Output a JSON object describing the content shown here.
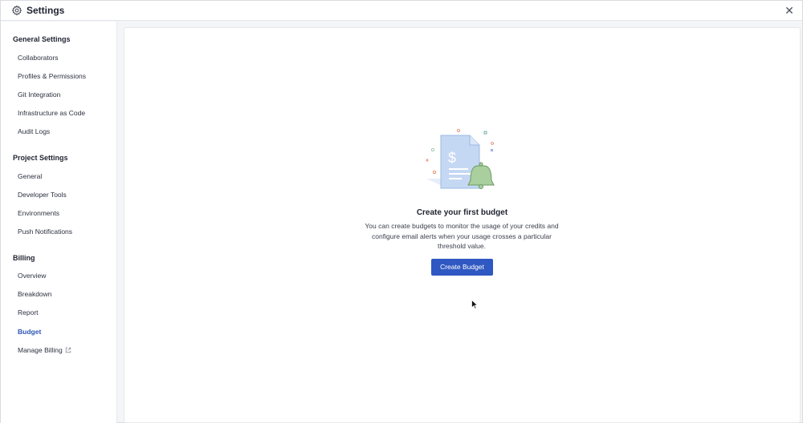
{
  "window": {
    "title": "Settings",
    "title_icon": "gear-icon",
    "close_glyph": "✕"
  },
  "sidebar": {
    "sections": [
      {
        "title": "General Settings",
        "items": [
          {
            "label": "Collaborators"
          },
          {
            "label": "Profiles & Permissions"
          },
          {
            "label": "Git Integration"
          },
          {
            "label": "Infrastructure as Code"
          },
          {
            "label": "Audit Logs"
          }
        ]
      },
      {
        "title": "Project Settings",
        "items": [
          {
            "label": "General"
          },
          {
            "label": "Developer Tools"
          },
          {
            "label": "Environments"
          },
          {
            "label": "Push Notifications"
          }
        ]
      },
      {
        "title": "Billing",
        "items": [
          {
            "label": "Overview"
          },
          {
            "label": "Breakdown"
          },
          {
            "label": "Report"
          },
          {
            "label": "Budget",
            "active": true
          },
          {
            "label": "Manage Billing",
            "icon": "external-link-icon"
          }
        ]
      }
    ]
  },
  "main": {
    "empty_state": {
      "illustration": "budget-document-bell-illustration",
      "illustration_symbol": "$",
      "title": "Create your first budget",
      "description": "You can create budgets to monitor the usage of your credits and configure email alerts when your usage crosses a particular threshold value.",
      "button_label": "Create Budget"
    }
  },
  "colors": {
    "accent": "#2f58c2",
    "active_nav": "#2c55b8",
    "illustration_doc": "#c5d8f3",
    "illustration_bell": "#a9cf9f"
  }
}
